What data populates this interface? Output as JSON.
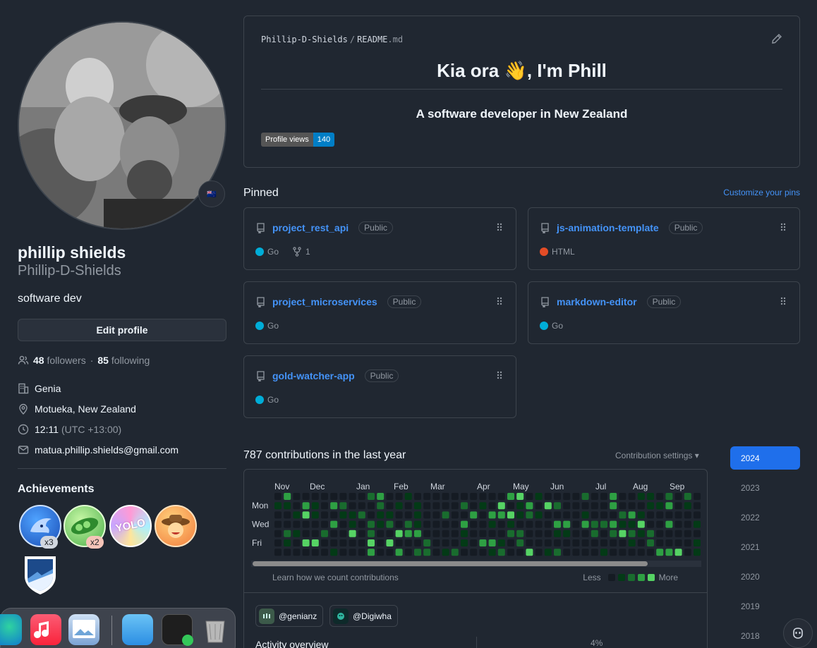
{
  "profile": {
    "full_name": "phillip shields",
    "username": "Phillip-D-Shields",
    "bio": "software dev",
    "edit_label": "Edit profile",
    "followers_count": "48",
    "followers_label": "followers",
    "separator": "·",
    "following_count": "85",
    "following_label": "following",
    "company": "Genia",
    "location": "Motueka, New Zealand",
    "local_time": "12:11",
    "timezone": "(UTC +13:00)",
    "email": "matua.phillip.shields@gmail.com",
    "status_emoji": "🇳🇿"
  },
  "achievements": {
    "title": "Achievements",
    "badges": [
      {
        "name": "Pull Shark",
        "count": "x3"
      },
      {
        "name": "Pair Extraordinaire",
        "count": "x2"
      },
      {
        "name": "YOLO",
        "count": ""
      },
      {
        "name": "Quickdraw",
        "count": ""
      },
      {
        "name": "Arctic Code Vault",
        "count": ""
      }
    ],
    "yolo_text": "YOLO"
  },
  "readme": {
    "owner": "Phillip-D-Shields",
    "sep": "/",
    "file": "README",
    "ext": ".md",
    "heading": "Kia ora 👋, I'm Phill",
    "subheading": "A software developer in New Zealand",
    "views_label": "Profile views",
    "views_count": "140"
  },
  "pinned": {
    "title": "Pinned",
    "customize_label": "Customize your pins",
    "repos": [
      {
        "name": "project_rest_api",
        "visibility": "Public",
        "language": "Go",
        "color": "#00ADD8",
        "forks": "1"
      },
      {
        "name": "js-animation-template",
        "visibility": "Public",
        "language": "HTML",
        "color": "#e34c26",
        "forks": ""
      },
      {
        "name": "project_microservices",
        "visibility": "Public",
        "language": "Go",
        "color": "#00ADD8",
        "forks": ""
      },
      {
        "name": "markdown-editor",
        "visibility": "Public",
        "language": "Go",
        "color": "#00ADD8",
        "forks": ""
      },
      {
        "name": "gold-watcher-app",
        "visibility": "Public",
        "language": "Go",
        "color": "#00ADD8",
        "forks": ""
      }
    ]
  },
  "contributions": {
    "title": "787 contributions in the last year",
    "settings_label": "Contribution settings ▾",
    "months": [
      "Nov",
      "Dec",
      "Jan",
      "Feb",
      "Mar",
      "Apr",
      "May",
      "Jun",
      "Jul",
      "Aug",
      "Sep"
    ],
    "days": [
      "Mon",
      "Wed",
      "Fri"
    ],
    "learn_label": "Learn how we count contributions",
    "less_label": "Less",
    "more_label": "More",
    "level_colors": [
      "#151b23",
      "#033a16",
      "#196c2e",
      "#2ea043",
      "#56d364"
    ]
  },
  "orgs": [
    {
      "handle": "@genianz"
    },
    {
      "handle": "@Digiwha"
    }
  ],
  "activity": {
    "title": "Activity overview",
    "percent": "4%"
  },
  "years": [
    "2024",
    "2023",
    "2022",
    "2021",
    "2020",
    "2019",
    "2018"
  ],
  "colors": {
    "bg": "#202731",
    "border": "#3d444d",
    "link": "#4493f8",
    "accent": "#1f6feb"
  }
}
